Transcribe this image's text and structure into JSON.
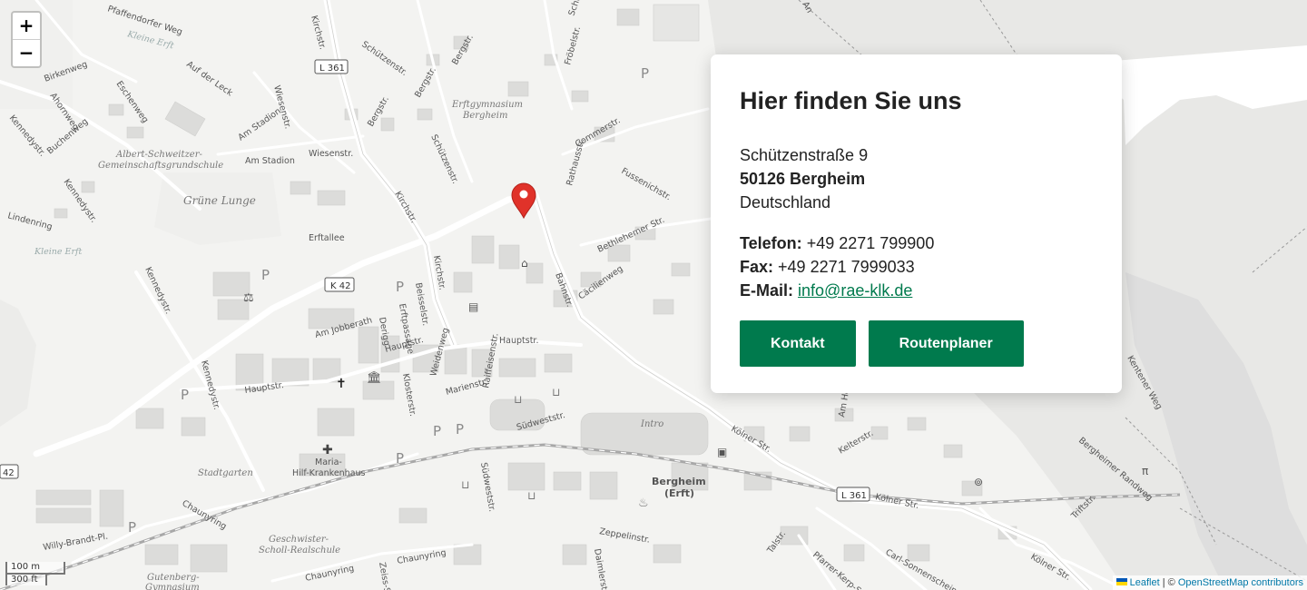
{
  "map": {
    "zoom_in": "+",
    "zoom_out": "−",
    "scale_metric": "100 m",
    "scale_imperial": "300 ft",
    "attribution": {
      "leaflet": "Leaflet",
      "separator": " | © ",
      "osm": "OpenStreetMap contributors"
    },
    "marker_icon": "map-pin-icon",
    "labels": {
      "pfaffendorfer": "Pfaffendorfer Weg",
      "kleine_erft_top": "Kleine Erft",
      "birkenweg": "Birkenweg",
      "ahornweg": "Ahornweg",
      "eschenweg": "Eschenweg",
      "auf_der_leck": "Auf der Leck",
      "kennedystr1": "Kennedystr.",
      "buchenweg": "Buchenweg",
      "albert1": "Albert-Schweitzer-",
      "albert2": "Gemeinschaftsgrundschule",
      "am_stadion1": "Am Stadion",
      "am_stadion2": "Am Stadion",
      "wiesenstr1": "Wiesenstr.",
      "wiesenstr2": "Wiesenstr.",
      "kirchstr_top": "Kirchstr.",
      "l361_top": "L 361",
      "schuetzenstr1": "Schützenstr.",
      "bergstr1": "Bergstr.",
      "bergstr2": "Bergstr.",
      "bergstr3": "Bergstr.",
      "erftgym1": "Erftgymnasium",
      "erftgym2": "Bergheim",
      "schulstr": "Schulstr.",
      "froebelstr": "Fröbelstr.",
      "commerstr": "Commerstr.",
      "rathausstr": "Rathausstr.",
      "fussenichstr": "Fussenichstr.",
      "schuetzenstr2": "Schützenstr.",
      "gruene_lunge": "Grüne Lunge",
      "kennedystr2": "Kennedystr.",
      "lindenring": "Lindenring",
      "kleine_erft_mid": "Kleine Erft",
      "erftallee": "Erftallee",
      "kirchstr_mid": "Kirchstr.",
      "kirchstr_mid2": "Kirchstr.",
      "bahnstr": "Bahnstr.",
      "bethlehemer": "Bethlehemer Str.",
      "caecilienweg": "Cäcilienweg",
      "k42": "K 42",
      "kennedystr3": "Kennedystr.",
      "beisselstr": "Beisselstr.",
      "erftpassage": "Erftpassage",
      "derigg": "Derigg",
      "jobberath": "Am Jobberath",
      "hauptstr1": "Hauptstr.",
      "hauptstr2": "Hauptstr.",
      "hauptstr3": "Hauptstr.",
      "kennedystr4": "Kennedystr.",
      "klosterstr": "Klosterstr.",
      "weidenweg": "Weidenweg",
      "marienstr": "Marienstr.",
      "raiffeisenstr": "Raiffeisenstr.",
      "suedweststr": "Südweststr.",
      "suedweststr2": "Südweststr.",
      "intro": "Intro",
      "koelner1": "Kölner Str.",
      "koelner2": "Kölner Str.",
      "koelner3": "Kölner Str.",
      "l361_bot": "L 361",
      "maria1": "Maria-",
      "maria2": "Hilf-Krankenhaus",
      "stadtgarten": "Stadtgarten",
      "bergheim1": "Bergheim",
      "bergheim2": "(Erft)",
      "k42_left": "42",
      "chaunyring1": "Chaunyring",
      "chaunyring2": "Chaunyring",
      "chaunyring3": "Chaunyring",
      "geschwister1": "Geschwister-",
      "geschwister2": "Scholl-Realschule",
      "willy": "Willy-Brandt-Pl.",
      "gutenberg1": "Gutenberg-",
      "gutenberg2": "Gymnasium",
      "zeppelinstr": "Zeppelinstr.",
      "daimlerstr": "Daimlerstr.",
      "talstr": "Talstr.",
      "pfarrer": "Pfarrer-Kerp-Str.",
      "carl": "Carl-Sonnenschein-",
      "trift": "Triftstr.",
      "randweg": "Bergheimer Randweg",
      "kentener": "Kentener Weg",
      "kelterstr": "Kelterstr.",
      "am_he": "Am He",
      "zeiss": "Zeiss-Str.",
      "an_top": "An"
    }
  },
  "card": {
    "title": "Hier finden Sie uns",
    "street": "Schützenstraße 9",
    "city": "50126 Bergheim",
    "country": "Deutschland",
    "phone_label": "Telefon:",
    "phone": "+49 2271 799900",
    "fax_label": "Fax:",
    "fax": "+49 2271 7999033",
    "email_label": "E-Mail:",
    "email": "info@rae-klk.de",
    "btn_contact": "Kontakt",
    "btn_route": "Routenplaner"
  },
  "colors": {
    "accent": "#007a4d",
    "marker": "#e0322a"
  }
}
